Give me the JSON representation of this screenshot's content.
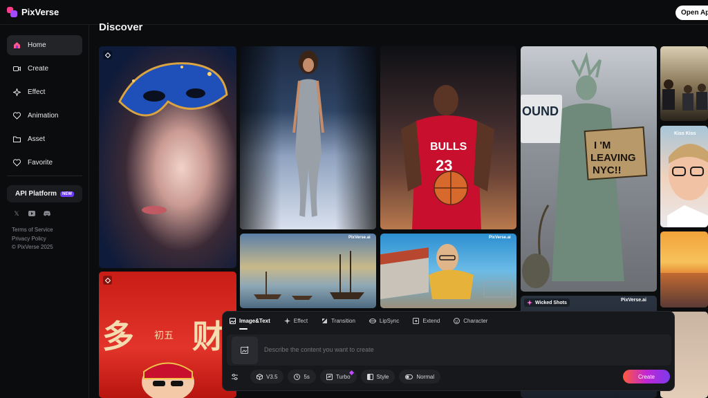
{
  "brand": {
    "name": "PixVerse",
    "open_app_label": "Open App",
    "logo_colors": [
      "#ff3d8b",
      "#a24bff"
    ]
  },
  "page": {
    "title": "Discover"
  },
  "sidebar": {
    "items": [
      {
        "label": "Home",
        "icon": "home-icon",
        "active": true
      },
      {
        "label": "Create",
        "icon": "video-icon"
      },
      {
        "label": "Effect",
        "icon": "sparkle-icon"
      },
      {
        "label": "Animation",
        "icon": "heart-icon"
      },
      {
        "label": "Asset",
        "icon": "folder-icon"
      },
      {
        "label": "Favorite",
        "icon": "heart-outline-icon"
      }
    ],
    "api_platform": {
      "label": "API Platform",
      "badge": "NEW"
    },
    "socials": [
      "x-icon",
      "youtube-icon",
      "discord-icon"
    ],
    "footer": {
      "terms": "Terms of Service",
      "privacy": "Privacy Policy",
      "copyright": "© PixVerse 2025"
    }
  },
  "gallery": {
    "tiles": [
      {
        "name": "masked-woman-tile",
        "subject": "woman with blue masquerade mask"
      },
      {
        "name": "runway-model-tile",
        "subject": "model in silver dress on runway"
      },
      {
        "name": "basketball-player-tile",
        "subject": "player in Bulls 23 jersey holding ball"
      },
      {
        "name": "statue-of-liberty-tile",
        "subject": "statue holding sign",
        "sign_text": "I'M LEAVING NYC!!"
      },
      {
        "name": "meeting-room-tile",
        "subject": "people at a meeting"
      },
      {
        "name": "sailing-ships-tile",
        "subject": "painting of sailing ships",
        "watermark": "PixVerse.ai"
      },
      {
        "name": "giant-man-tile",
        "subject": "giant man beside store",
        "watermark": "PixVerse.ai"
      },
      {
        "name": "kiss-kiss-tile",
        "subject": "man with glasses",
        "label": "Kiss Kiss"
      },
      {
        "name": "lunar-new-year-tile",
        "subject": "red new year poster",
        "chars": [
          "多",
          "初五",
          "财"
        ]
      },
      {
        "name": "wicked-shots-tile",
        "label": "Wicked Shots",
        "watermark": "PixVerse.ai"
      },
      {
        "name": "sunset-sea-tile",
        "subject": "sunset over sea"
      }
    ]
  },
  "creator": {
    "tabs": [
      {
        "label": "Image&Text",
        "icon": "image-text-icon",
        "active": true
      },
      {
        "label": "Effect",
        "icon": "sparkle-icon"
      },
      {
        "label": "Transition",
        "icon": "transition-icon"
      },
      {
        "label": "LipSync",
        "icon": "lips-icon"
      },
      {
        "label": "Extend",
        "icon": "extend-icon"
      },
      {
        "label": "Character",
        "icon": "character-icon"
      }
    ],
    "prompt_placeholder": "Describe the content you want to create",
    "options": [
      {
        "label": "V3.5",
        "icon": "cube-icon"
      },
      {
        "label": "5s",
        "icon": "clock-icon"
      },
      {
        "label": "Turbo",
        "icon": "turbo-icon"
      },
      {
        "label": "Style",
        "icon": "style-icon"
      },
      {
        "label": "Normal",
        "icon": "toggle-icon"
      }
    ],
    "create_label": "Create"
  },
  "colors": {
    "background": "#0b0c0e",
    "panel": "#17181b",
    "accent_gradient": [
      "#ff5a3c",
      "#c026d3",
      "#7c3aed"
    ]
  }
}
